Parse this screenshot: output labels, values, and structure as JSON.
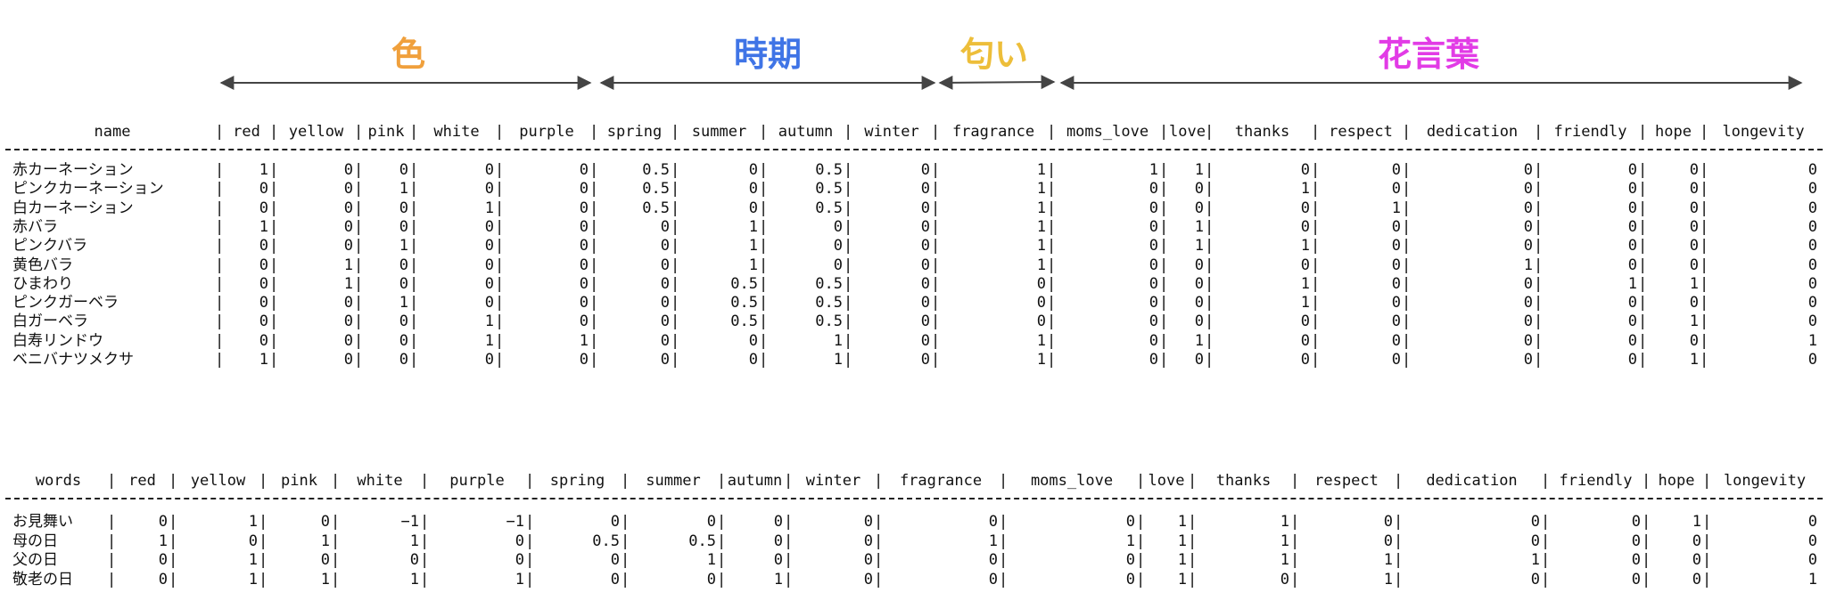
{
  "groups": [
    {
      "label": "色",
      "color": "#F0A03C"
    },
    {
      "label": "時期",
      "color": "#3F74E6"
    },
    {
      "label": "匂い",
      "color": "#EDBE3A"
    },
    {
      "label": "花言葉",
      "color": "#E23BE6"
    }
  ],
  "table1": {
    "columns": [
      "name",
      "red",
      "yellow",
      "pink",
      "white",
      "purple",
      "spring",
      "summer",
      "autumn",
      "winter",
      "fragrance",
      "moms_love",
      "love",
      "thanks",
      "respect",
      "dedication",
      "friendly",
      "hope",
      "longevity"
    ],
    "rows": [
      [
        "赤カーネーション",
        "1",
        "0",
        "0",
        "0",
        "0",
        "0.5",
        "0",
        "0.5",
        "0",
        "1",
        "1",
        "1",
        "0",
        "0",
        "0",
        "0",
        "0",
        "0"
      ],
      [
        "ピンクカーネーション",
        "0",
        "0",
        "1",
        "0",
        "0",
        "0.5",
        "0",
        "0.5",
        "0",
        "1",
        "0",
        "0",
        "1",
        "0",
        "0",
        "0",
        "0",
        "0"
      ],
      [
        "白カーネーション",
        "0",
        "0",
        "0",
        "1",
        "0",
        "0.5",
        "0",
        "0.5",
        "0",
        "1",
        "0",
        "0",
        "0",
        "1",
        "0",
        "0",
        "0",
        "0"
      ],
      [
        "赤バラ",
        "1",
        "0",
        "0",
        "0",
        "0",
        "0",
        "1",
        "0",
        "0",
        "1",
        "0",
        "1",
        "0",
        "0",
        "0",
        "0",
        "0",
        "0"
      ],
      [
        "ピンクバラ",
        "0",
        "0",
        "1",
        "0",
        "0",
        "0",
        "1",
        "0",
        "0",
        "1",
        "0",
        "1",
        "1",
        "0",
        "0",
        "0",
        "0",
        "0"
      ],
      [
        "黄色バラ",
        "0",
        "1",
        "0",
        "0",
        "0",
        "0",
        "1",
        "0",
        "0",
        "1",
        "0",
        "0",
        "0",
        "0",
        "1",
        "0",
        "0",
        "0"
      ],
      [
        "ひまわり",
        "0",
        "1",
        "0",
        "0",
        "0",
        "0",
        "0.5",
        "0.5",
        "0",
        "0",
        "0",
        "0",
        "1",
        "0",
        "0",
        "1",
        "1",
        "0"
      ],
      [
        "ピンクガーベラ",
        "0",
        "0",
        "1",
        "0",
        "0",
        "0",
        "0.5",
        "0.5",
        "0",
        "0",
        "0",
        "0",
        "1",
        "0",
        "0",
        "0",
        "0",
        "0"
      ],
      [
        "白ガーベラ",
        "0",
        "0",
        "0",
        "1",
        "0",
        "0",
        "0.5",
        "0.5",
        "0",
        "0",
        "0",
        "0",
        "0",
        "0",
        "0",
        "0",
        "1",
        "0"
      ],
      [
        "白寿リンドウ",
        "0",
        "0",
        "0",
        "1",
        "1",
        "0",
        "0",
        "1",
        "0",
        "1",
        "0",
        "1",
        "0",
        "0",
        "0",
        "0",
        "0",
        "1"
      ],
      [
        "ベニバナツメクサ",
        "1",
        "0",
        "0",
        "0",
        "0",
        "0",
        "0",
        "1",
        "0",
        "1",
        "0",
        "0",
        "0",
        "0",
        "0",
        "0",
        "1",
        "0"
      ]
    ]
  },
  "table2": {
    "columns": [
      "words",
      "red",
      "yellow",
      "pink",
      "white",
      "purple",
      "spring",
      "summer",
      "autumn",
      "winter",
      "fragrance",
      "moms_love",
      "love",
      "thanks",
      "respect",
      "dedication",
      "friendly",
      "hope",
      "longevity"
    ],
    "rows": [
      [
        "お見舞い",
        "0",
        "1",
        "0",
        "−1",
        "−1",
        "0",
        "0",
        "0",
        "0",
        "0",
        "0",
        "1",
        "1",
        "0",
        "0",
        "0",
        "1",
        "0"
      ],
      [
        "母の日",
        "1",
        "0",
        "1",
        "1",
        "0",
        "0.5",
        "0.5",
        "0",
        "0",
        "1",
        "1",
        "1",
        "1",
        "0",
        "0",
        "0",
        "0",
        "0"
      ],
      [
        "父の日",
        "0",
        "1",
        "0",
        "0",
        "0",
        "0",
        "1",
        "0",
        "0",
        "0",
        "0",
        "1",
        "1",
        "1",
        "1",
        "0",
        "0",
        "0"
      ],
      [
        "敬老の日",
        "0",
        "1",
        "1",
        "1",
        "1",
        "0",
        "0",
        "1",
        "0",
        "0",
        "0",
        "1",
        "0",
        "1",
        "0",
        "0",
        "0",
        "1"
      ]
    ]
  }
}
